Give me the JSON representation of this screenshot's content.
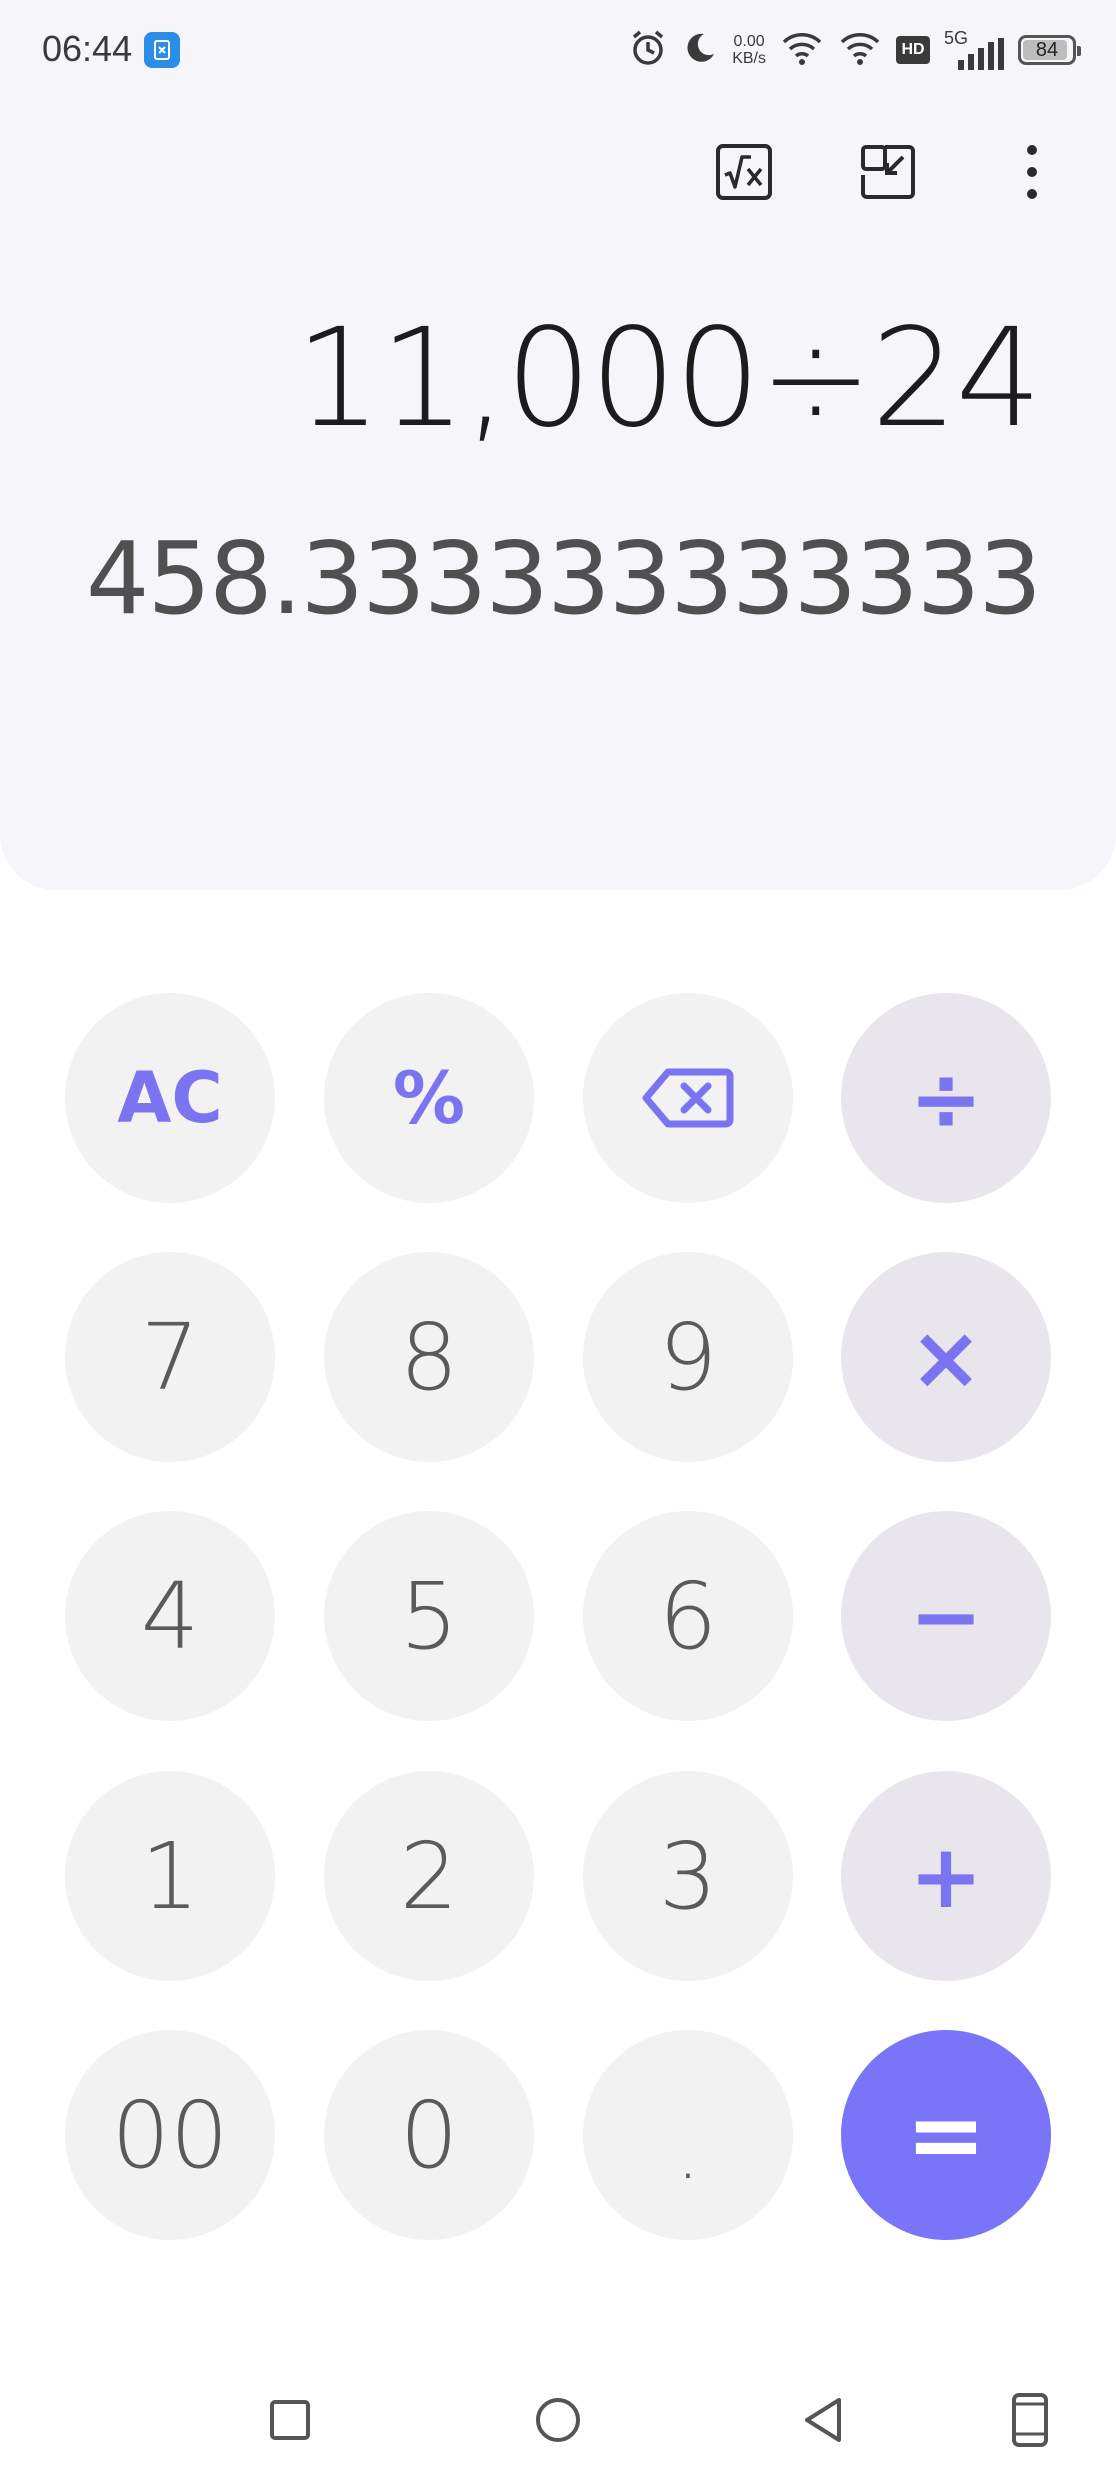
{
  "status_bar": {
    "time": "06:44",
    "speed_value": "0.00",
    "speed_unit": "KB/s",
    "hd": "HD",
    "network": "5G",
    "battery": "84"
  },
  "display": {
    "expression": "11,000÷24",
    "result": "458.333333333333"
  },
  "keys": {
    "clear": "AC",
    "percent": "%",
    "divide": "÷",
    "seven": "7",
    "eight": "8",
    "nine": "9",
    "multiply": "×",
    "four": "4",
    "five": "5",
    "six": "6",
    "subtract": "−",
    "one": "1",
    "two": "2",
    "three": "3",
    "add": "+",
    "double_zero": "00",
    "zero": "0",
    "decimal": ".",
    "equals": "="
  },
  "colors": {
    "accent": "#7a74f8",
    "panel_bg": "#f5f5fa",
    "key_bg": "#f2f2f3",
    "op_key_bg": "#e8e6ec"
  }
}
